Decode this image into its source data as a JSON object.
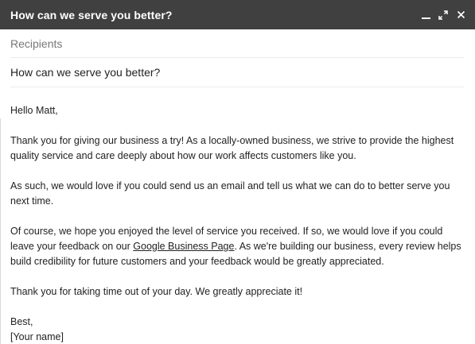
{
  "window": {
    "title": "How can we serve you better?",
    "controls": {
      "minimize_icon": "minimize-icon",
      "expand_icon": "expand-icon",
      "close_icon": "close-icon"
    },
    "titlebar_color": "#404040"
  },
  "fields": {
    "recipients_placeholder": "Recipients",
    "recipients_value": "",
    "subject_value": "How can we serve you better?"
  },
  "body": {
    "greeting": "Hello Matt,",
    "para1": "Thank you for giving our business a try! As a locally-owned business, we strive to provide the highest quality service and care deeply about how our work affects customers like you.",
    "para2": "As such, we would love if you could send us an email and tell us what we can do to better serve you next time.",
    "para3_before_link": "Of course, we hope you enjoyed the level of service you received. If so, we would love if you could leave your feedback on our ",
    "para3_link": "Google Business Page",
    "para3_after_link": ". As we're building our business, every review helps build credibility for future customers and your feedback would be greatly appreciated.",
    "para4": "Thank you for taking time out of your day. We greatly appreciate it!",
    "closing": "Best,",
    "signature": "[Your name]"
  }
}
